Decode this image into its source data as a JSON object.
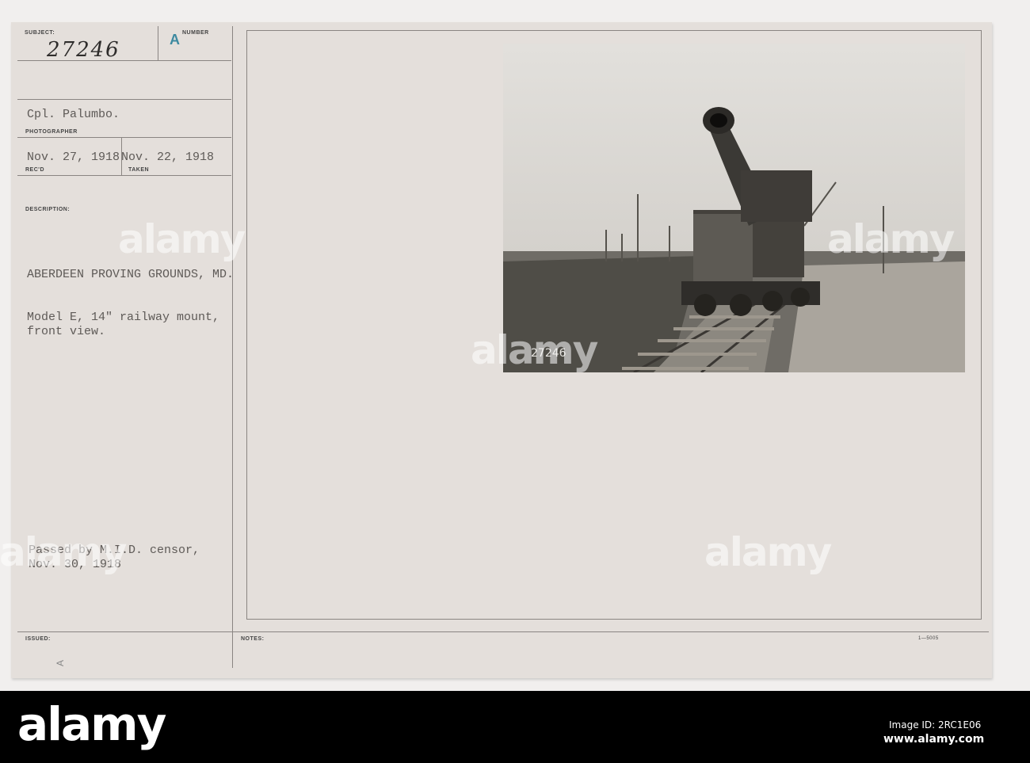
{
  "card": {
    "subject_label": "SUBJECT:",
    "number_label": "NUMBER",
    "number_value": "27246",
    "stamp": "A",
    "photographer": "Cpl. Palumbo.",
    "photographer_label": "PHOTOGRAPHER",
    "received_date": "Nov. 27, 1918",
    "received_label": "REC'D",
    "taken_date": "Nov. 22, 1918",
    "taken_label": "TAKEN",
    "description_label": "DESCRIPTION:",
    "location": "ABERDEEN PROVING GROUNDS, MD.",
    "description_line1": "Model E, 14\" railway mount,",
    "description_line2": "front view.",
    "censor_line1": "Passed by M.I.D. censor,",
    "censor_line2": "Nov. 30, 1918",
    "issued_label": "ISSUED:",
    "issued_mark": "A",
    "notes_label": "NOTES:",
    "form_number": "1—5005",
    "photo_caption": "27246"
  },
  "watermark": {
    "logo": "alamy",
    "image_id": "Image ID: 2RC1E06",
    "site": "www.alamy.com"
  }
}
